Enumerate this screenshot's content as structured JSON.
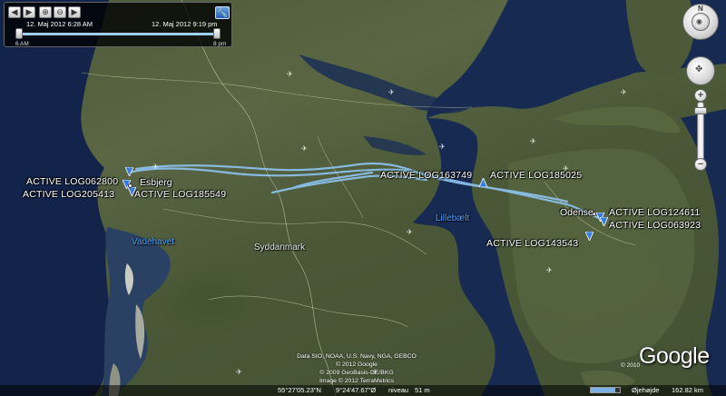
{
  "time_slider": {
    "start_date": "12. Maj 2012   6:28 AM",
    "end_date": "12. Maj 2012   9:19 pm",
    "tick_start": "6 AM",
    "tick_end": "8 pm",
    "start_fraction": 0.0,
    "end_fraction": 1.0
  },
  "track_labels": [
    "ACTIVE LOG062800",
    "ACTIVE LOG205413",
    "ACTIVE LOG185549",
    "ACTIVE LOG163749",
    "ACTIVE LOG185025",
    "ACTIVE LOG124611",
    "ACTIVE LOG063923",
    "ACTIVE LOG143543"
  ],
  "places": {
    "esbjerg": "Esbjerg",
    "odense": "Odense",
    "lillebaelt": "Lillebælt",
    "vadehavet": "Vadehavet",
    "syddanmark": "Syddanmark"
  },
  "credits": {
    "line1": "Data SIO, NOAA, U.S. Navy, NGA, GEBCO",
    "line2": "© 2012 Google",
    "line3": "© 2009 GeoBasis-DE/BKG",
    "line4": "Image © 2012 TerraMetrics"
  },
  "brand": {
    "logo": "Google",
    "year": "© 2010"
  },
  "status_bar": {
    "coordinates": "55°27'05.23\"N",
    "longitude": "9°24'47.67\"Ø",
    "elevation_label": "niveau",
    "elevation_value": "51 m",
    "eye_label": "Øjehøjde",
    "eye_value": "162.82 km",
    "stream_progress": 0.85
  },
  "colors": {
    "track": "#8ec4f2",
    "water": "#162a52",
    "land": "#55613f",
    "border": "#dfe7b8"
  },
  "icons": {
    "track_marker": "triangle-marker-icon",
    "airport": "airplane-icon",
    "nav": "compass-icon",
    "wrench": "wrench-icon"
  }
}
